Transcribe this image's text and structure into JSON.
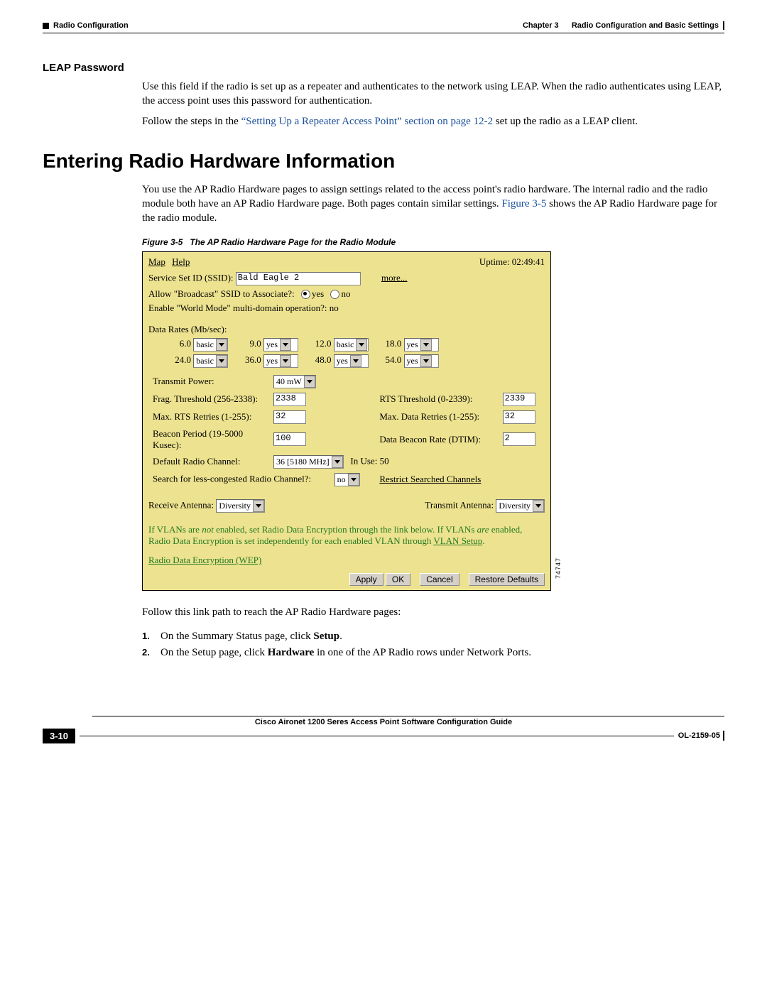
{
  "header": {
    "chapter": "Chapter 3",
    "chapter_title": "Radio Configuration and Basic Settings",
    "section": "Radio Configuration"
  },
  "leap": {
    "heading": "LEAP Password",
    "p1": "Use this field if the radio is set up as a repeater and authenticates to the network using LEAP. When the radio authenticates using LEAP, the access point uses this password for authentication.",
    "p2a": "Follow the steps in the ",
    "p2link": "“Setting Up a Repeater Access Point” section on page 12-2",
    "p2b": " set up the radio as a LEAP client."
  },
  "main": {
    "h1": "Entering Radio Hardware Information",
    "intro_a": "You use the AP Radio Hardware pages to assign settings related to the access point's radio hardware. The internal radio and the radio module both have an AP Radio Hardware page. Both pages contain similar settings. ",
    "intro_link": "Figure 3-5",
    "intro_b": " shows the AP Radio Hardware page for the radio module.",
    "figcap_num": "Figure 3-5",
    "figcap_title": "The AP Radio Hardware Page for the Radio Module",
    "follow": "Follow this link path to reach the AP Radio Hardware pages:",
    "step1_n": "1.",
    "step1_a": "On the Summary Status page, click ",
    "step1_b": "Setup",
    "step1_c": ".",
    "step2_n": "2.",
    "step2_a": "On the Setup page, click ",
    "step2_b": "Hardware",
    "step2_c": " in one of the AP Radio rows under Network Ports."
  },
  "shot": {
    "menu_map": "Map",
    "menu_help": "Help",
    "uptime": "Uptime: 02:49:41",
    "ssid_label": "Service Set ID (SSID):",
    "ssid_value": "Bald Eagle 2",
    "more": "more...",
    "broadcast_label": "Allow \"Broadcast\" SSID to Associate?:",
    "yes": "yes",
    "no": "no",
    "world_label": "Enable \"World Mode\" multi-domain operation?:  no",
    "rates_label": "Data Rates  (Mb/sec):",
    "rates": [
      {
        "n": "6.0",
        "v": "basic"
      },
      {
        "n": "9.0",
        "v": "yes"
      },
      {
        "n": "12.0",
        "v": "basic"
      },
      {
        "n": "18.0",
        "v": "yes"
      },
      {
        "n": "24.0",
        "v": "basic"
      },
      {
        "n": "36.0",
        "v": "yes"
      },
      {
        "n": "48.0",
        "v": "yes"
      },
      {
        "n": "54.0",
        "v": "yes"
      }
    ],
    "tx_power_label": "Transmit Power:",
    "tx_power_value": "40 mW",
    "frag_label": "Frag. Threshold (256-2338):",
    "frag_value": "2338",
    "rts_label": "RTS Threshold (0-2339):",
    "rts_value": "2339",
    "maxrts_label": "Max. RTS Retries (1-255):",
    "maxrts_value": "32",
    "maxdata_label": "Max. Data Retries (1-255):",
    "maxdata_value": "32",
    "beacon_label": "Beacon Period (19-5000 Kusec):",
    "beacon_value": "100",
    "dtim_label": "Data Beacon Rate (DTIM):",
    "dtim_value": "2",
    "channel_label": "Default Radio Channel:",
    "channel_value": "36  [5180 MHz]",
    "inuse": "In Use: 50",
    "search_label": "Search for less-congested Radio Channel?:",
    "search_value": "no",
    "restrict": "Restrict Searched Channels",
    "rxant_label": "Receive Antenna:",
    "rxant_value": "Diversity",
    "txant_label": "Transmit Antenna:",
    "txant_value": "Diversity",
    "note_a": "If VLANs are ",
    "note_not": "not",
    "note_b": " enabled, set Radio Data Encryption through the link below. If VLANs ",
    "note_are": "are",
    "note_c": " enabled, Radio Data Encryption is set independently for each enabled VLAN through ",
    "note_link1": "VLAN Setup",
    "note_d": ".",
    "wep_link": "Radio Data Encryption (WEP)",
    "apply": "Apply",
    "ok": "OK",
    "cancel": "Cancel",
    "restore": "Restore Defaults",
    "sidenum": "74747"
  },
  "footer": {
    "doc": "Cisco Aironet 1200 Seres Access Point Software Configuration Guide",
    "pagenum": "3-10",
    "ol": "OL-2159-05"
  }
}
